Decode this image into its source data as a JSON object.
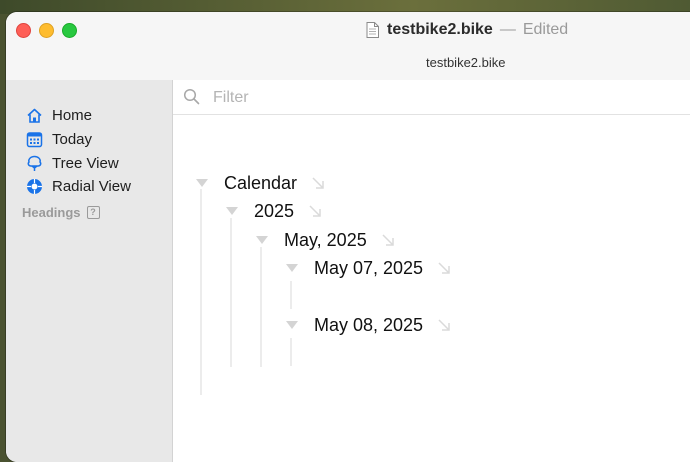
{
  "window": {
    "doc_title": "testbike2.bike",
    "separator": "—",
    "status": "Edited",
    "tab_title": "testbike2.bike"
  },
  "sidebar": {
    "items": [
      {
        "label": "Home",
        "icon": "house-icon"
      },
      {
        "label": "Today",
        "icon": "calendar-icon"
      },
      {
        "label": "Tree View",
        "icon": "tree-icon"
      },
      {
        "label": "Radial View",
        "icon": "radial-icon"
      }
    ],
    "headings_label": "Headings",
    "headings_help": "?"
  },
  "filter": {
    "placeholder": "Filter",
    "value": ""
  },
  "outline": {
    "rows": [
      {
        "text": "Calendar"
      },
      {
        "text": "2025"
      },
      {
        "text": "May, 2025"
      },
      {
        "text": "May 07, 2025"
      },
      {
        "text": "May 08, 2025"
      }
    ]
  },
  "colors": {
    "accent": "#1a73e8",
    "sidebar_bg": "#e8e8e8",
    "close": "#fe5f57",
    "minimize": "#febc2e",
    "maximize": "#28c840"
  }
}
